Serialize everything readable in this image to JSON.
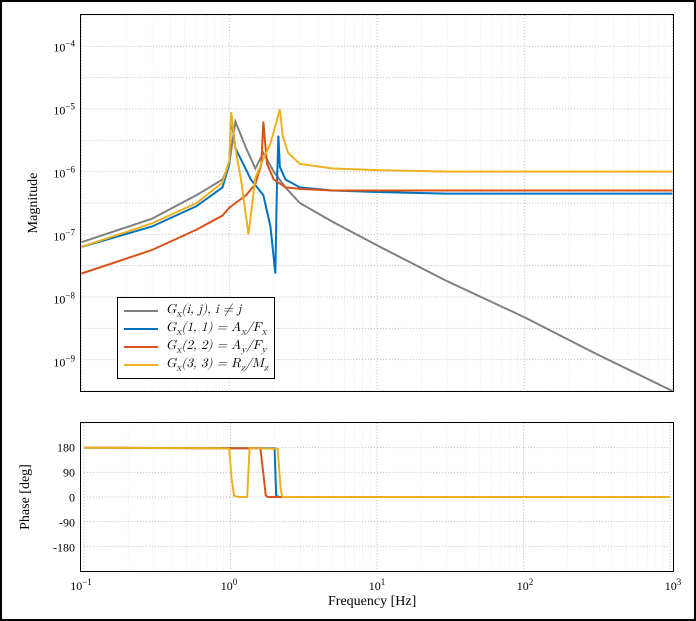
{
  "chart_data": [
    {
      "type": "line",
      "ylabel": "Magnitude",
      "xscale": "log",
      "xlim": [
        0.1,
        1000
      ],
      "ylim": [
        -200,
        40
      ],
      "yticks": [
        -200,
        -180,
        -160,
        -140,
        -120,
        -100,
        -80,
        -60,
        -40,
        -20,
        0,
        20,
        40
      ],
      "ytick_labels": [
        "",
        "10⁻⁹",
        "",
        "10⁻⁸",
        "",
        "10⁻⁷",
        "",
        "10⁻⁶",
        "",
        "10⁻⁵",
        "",
        "10⁻⁴",
        ""
      ],
      "xticks": [
        0.1,
        1,
        10,
        100,
        1000
      ],
      "series": [
        {
          "name": "Gx(i,j), i≠j",
          "color": "#808080",
          "x": [
            0.1,
            0.3,
            0.6,
            0.9,
            1.0,
            1.1,
            1.3,
            1.5,
            1.7,
            2.0,
            2.4,
            3,
            5,
            10,
            30,
            100,
            300,
            1000
          ],
          "y": [
            -105,
            -90,
            -75,
            -65,
            -55,
            -28,
            -45,
            -58,
            -48,
            -60,
            -70,
            -80,
            -92,
            -107,
            -130,
            -153,
            -176,
            -200
          ]
        },
        {
          "name": "Gx(1,1) = Ax/Fx",
          "color": "#0072BD",
          "x": [
            0.1,
            0.3,
            0.6,
            0.9,
            1.0,
            1.03,
            1.1,
            1.4,
            1.7,
            1.9,
            2.05,
            2.1,
            2.15,
            2.2,
            2.4,
            3,
            5,
            10,
            30,
            100,
            1000
          ],
          "y": [
            -108,
            -95,
            -82,
            -70,
            -55,
            -25,
            -45,
            -65,
            -75,
            -95,
            -125,
            -70,
            -37,
            -57,
            -65,
            -70,
            -72,
            -73,
            -74,
            -74,
            -74
          ]
        },
        {
          "name": "Gx(2,2) = Ay/Fy",
          "color": "#D95319",
          "x": [
            0.1,
            0.3,
            0.6,
            0.9,
            1.0,
            1.3,
            1.5,
            1.65,
            1.7,
            1.8,
            2.0,
            2.4,
            3,
            5,
            10,
            30,
            100,
            1000
          ],
          "y": [
            -125,
            -110,
            -97,
            -88,
            -83,
            -75,
            -68,
            -55,
            -28,
            -55,
            -65,
            -70,
            -71,
            -72,
            -72,
            -72,
            -72,
            -72
          ]
        },
        {
          "name": "Gx(3,3) = Rz/Mz",
          "color": "#EDB120",
          "x": [
            0.1,
            0.3,
            0.6,
            0.9,
            1.0,
            1.03,
            1.1,
            1.2,
            1.35,
            1.5,
            1.7,
            1.9,
            2.1,
            2.2,
            2.3,
            2.5,
            3,
            5,
            10,
            30,
            100,
            1000
          ],
          "y": [
            -108,
            -93,
            -80,
            -67,
            -53,
            -22,
            -45,
            -65,
            -100,
            -64,
            -52,
            -42,
            -27,
            -20,
            -37,
            -48,
            -55,
            -58,
            -59,
            -60,
            -60,
            -60
          ]
        }
      ],
      "legend": {
        "entries": [
          {
            "label": "G_x(i,j),  i ≠ j",
            "color": "#808080"
          },
          {
            "label": "G_x(1,1) = A_x/F_x",
            "color": "#0072BD"
          },
          {
            "label": "G_x(2,2) = A_y/F_y",
            "color": "#D95319"
          },
          {
            "label": "G_x(3,3) = R_z/M_z",
            "color": "#EDB120"
          }
        ]
      }
    },
    {
      "type": "line",
      "ylabel": "Phase [deg]",
      "xlabel": "Frequency [Hz]",
      "xscale": "log",
      "xlim": [
        0.1,
        1000
      ],
      "ylim": [
        -270,
        270
      ],
      "yticks": [
        -180,
        -90,
        0,
        90,
        180
      ],
      "xticks": [
        0.1,
        1,
        10,
        100,
        1000
      ],
      "xtick_labels": [
        "10⁻¹",
        "10⁰",
        "10¹",
        "10²",
        "10³"
      ],
      "series": [
        {
          "name": "Gx(1,1)",
          "color": "#0072BD",
          "x": [
            0.1,
            0.9,
            2.0,
            2.05,
            2.1,
            2.15,
            1000
          ],
          "y": [
            180,
            178,
            178,
            5,
            2,
            0,
            0
          ]
        },
        {
          "name": "Gx(2,2)",
          "color": "#D95319",
          "x": [
            0.1,
            0.9,
            1.6,
            1.68,
            1.74,
            1.8,
            1000
          ],
          "y": [
            180,
            178,
            178,
            80,
            6,
            0,
            0
          ]
        },
        {
          "name": "Gx(3,3)",
          "color": "#EDB120",
          "x": [
            0.1,
            0.8,
            0.98,
            1.02,
            1.06,
            1.15,
            1.3,
            1.35,
            2.1,
            2.2,
            2.25,
            2.3,
            1000
          ],
          "y": [
            180,
            178,
            176,
            60,
            4,
            0,
            0,
            178,
            176,
            30,
            4,
            0,
            0
          ]
        }
      ]
    }
  ],
  "labels": {
    "mag_ylabel": "Magnitude",
    "phase_ylabel": "Phase [deg]",
    "xlabel": "Frequency [Hz]",
    "mag_ticks": {
      "m9": "−9",
      "m8": "−8",
      "m7": "−7",
      "m6": "−6",
      "m5": "−5",
      "m4": "−4"
    },
    "base10": "10",
    "phase_ticks": {
      "m180": "-180",
      "m90": "-90",
      "z": "0",
      "p90": "90",
      "p180": "180"
    },
    "x_exp": {
      "m1": "−1",
      "z": "0",
      "p1": "1",
      "p2": "2",
      "p3": "3"
    },
    "legend": {
      "l0a": "G",
      "l0b": "(i, j),  i ≠ j",
      "l1a": "G",
      "l1b": "(1, 1) = A",
      "l1c": "/F",
      "l2a": "G",
      "l2b": "(2, 2) = A",
      "l2c": "/F",
      "l3a": "G",
      "l3b": "(3, 3) = R",
      "l3c": "/M",
      "sx": "x",
      "sy": "y",
      "sz": "z"
    }
  }
}
